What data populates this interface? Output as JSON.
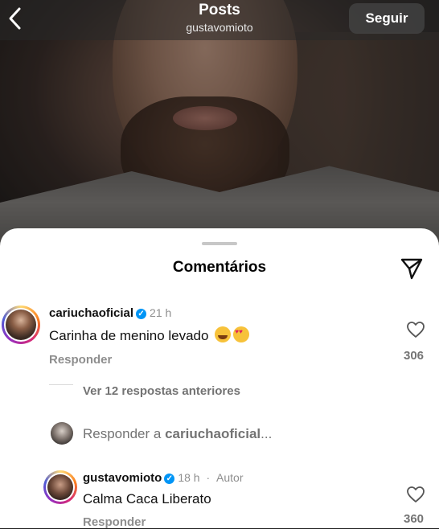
{
  "header": {
    "title": "Posts",
    "subtitle": "gustavomioto",
    "follow_label": "Seguir",
    "back_icon": "chevron-left-icon"
  },
  "sheet": {
    "title": "Comentários",
    "share_icon": "paper-plane-icon"
  },
  "comments": [
    {
      "username": "cariuchaoficial",
      "verified": true,
      "time": "21 h",
      "text": "Carinha de menino levado",
      "emojis": [
        "😂",
        "😍"
      ],
      "reply_label": "Responder",
      "likes": "306"
    },
    {
      "username": "gustavomioto",
      "verified": true,
      "time": "18 h",
      "author_label": "Autor",
      "text": "Calma Caca Liberato",
      "reply_label": "Responder",
      "likes": "360"
    }
  ],
  "view_replies": "Ver 12 respostas anteriores",
  "reply_input": {
    "prefix": "Responder a ",
    "target": "cariuchaoficial",
    "suffix": "..."
  },
  "colors": {
    "verified": "#0095f6",
    "muted": "#8e8e8e"
  }
}
